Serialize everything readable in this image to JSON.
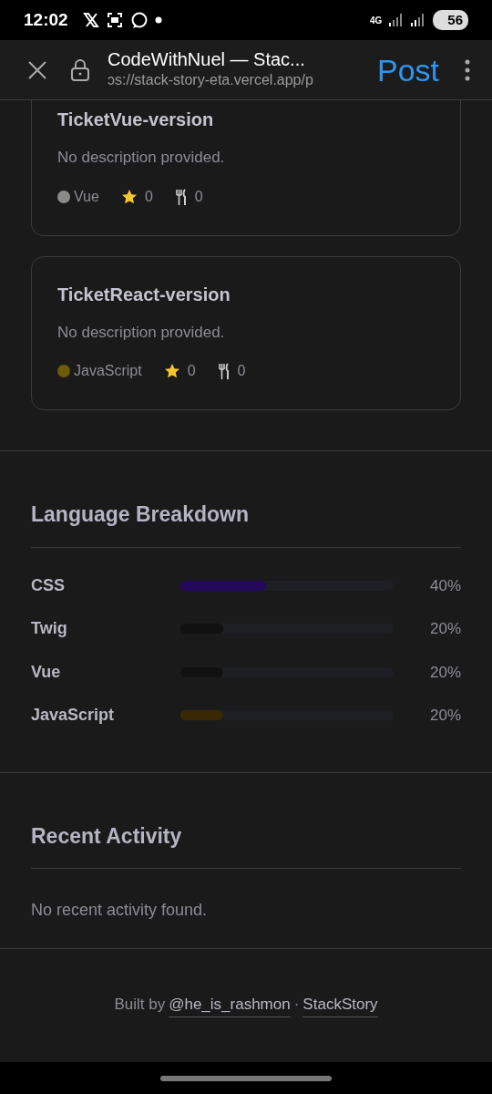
{
  "status_bar": {
    "time": "12:02",
    "network": "4G",
    "battery": "56"
  },
  "browser_bar": {
    "title": "CodeWithNuel — Stac...",
    "url": "ɔs://stack-story-eta.vercel.app/p",
    "action": "Post"
  },
  "repos": [
    {
      "name": "TicketVue-version",
      "description": "No description provided.",
      "language": "Vue",
      "color": "#8a8a8a",
      "stars": "0",
      "forks": "0",
      "cut_top": true
    },
    {
      "name": "TicketReact-version",
      "description": "No description provided.",
      "language": "JavaScript",
      "color": "#6e5b08",
      "stars": "0",
      "forks": "0",
      "cut_top": false
    }
  ],
  "language_breakdown": {
    "title": "Language Breakdown",
    "languages": [
      {
        "name": "CSS",
        "level": 0.4,
        "color": "#24085a",
        "reading": "40%"
      },
      {
        "name": "Twig",
        "level": 0.2,
        "color": "#111111",
        "reading": "20%"
      },
      {
        "name": "Vue",
        "level": 0.2,
        "color": "#111111",
        "reading": "20%"
      },
      {
        "name": "JavaScript",
        "level": 0.2,
        "color": "#3a2804",
        "reading": "20%"
      }
    ]
  },
  "recent_activity": {
    "title": "Recent Activity",
    "empty_text": "No recent activity found."
  },
  "footer": {
    "prefix": "Built by",
    "author_link": "@he_is_rashmon",
    "separator": "·",
    "site_link": "StackStory"
  }
}
